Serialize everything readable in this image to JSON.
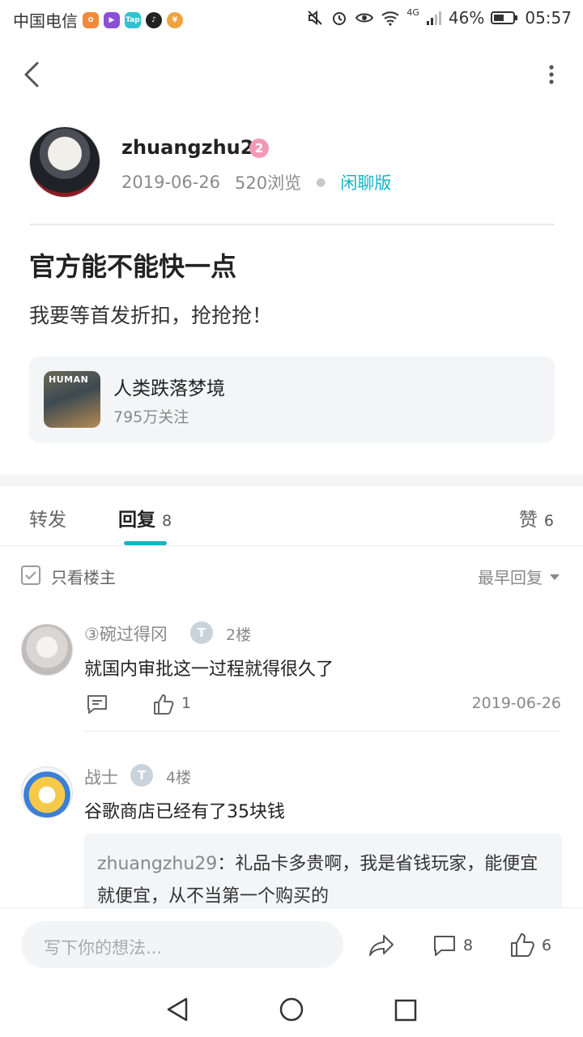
{
  "status_bar": {
    "carrier": "中国电信",
    "battery": "46%",
    "time": "05:57",
    "net": "4G"
  },
  "post": {
    "author": "zhuangzhu29",
    "level": "2",
    "date": "2019-06-26",
    "views": "520浏览",
    "forum": "闲聊版",
    "title": "官方能不能快一点",
    "body": "我要等首发折扣，抢抢抢！"
  },
  "game_card": {
    "icon_text": "HUMAN",
    "name": "人类跌落梦境",
    "follows": "795万关注"
  },
  "tabs": {
    "repost": "转发",
    "reply": "回复",
    "reply_count": "8",
    "like": "赞",
    "like_count": "6"
  },
  "filter": {
    "only_op": "只看楼主",
    "sort": "最早回复"
  },
  "replies": [
    {
      "name": "③碗过得冈",
      "badge": "T",
      "floor": "2楼",
      "text": "就国内审批这一过程就得很久了",
      "likes": "1",
      "date": "2019-06-26"
    },
    {
      "name": "战士",
      "badge": "T",
      "floor": "4楼",
      "text": "谷歌商店已经有了35块钱",
      "quote_name": "zhuangzhu29",
      "quote_text": "：礼品卡多贵啊，我是省钱玩家，能便宜就便宜，从不当第一个购买的"
    }
  ],
  "bottom_bar": {
    "placeholder": "写下你的想法...",
    "comment_count": "8",
    "like_count": "6"
  },
  "colors": {
    "accent": "#14b4c4",
    "level_badge": "#f29ab4"
  }
}
